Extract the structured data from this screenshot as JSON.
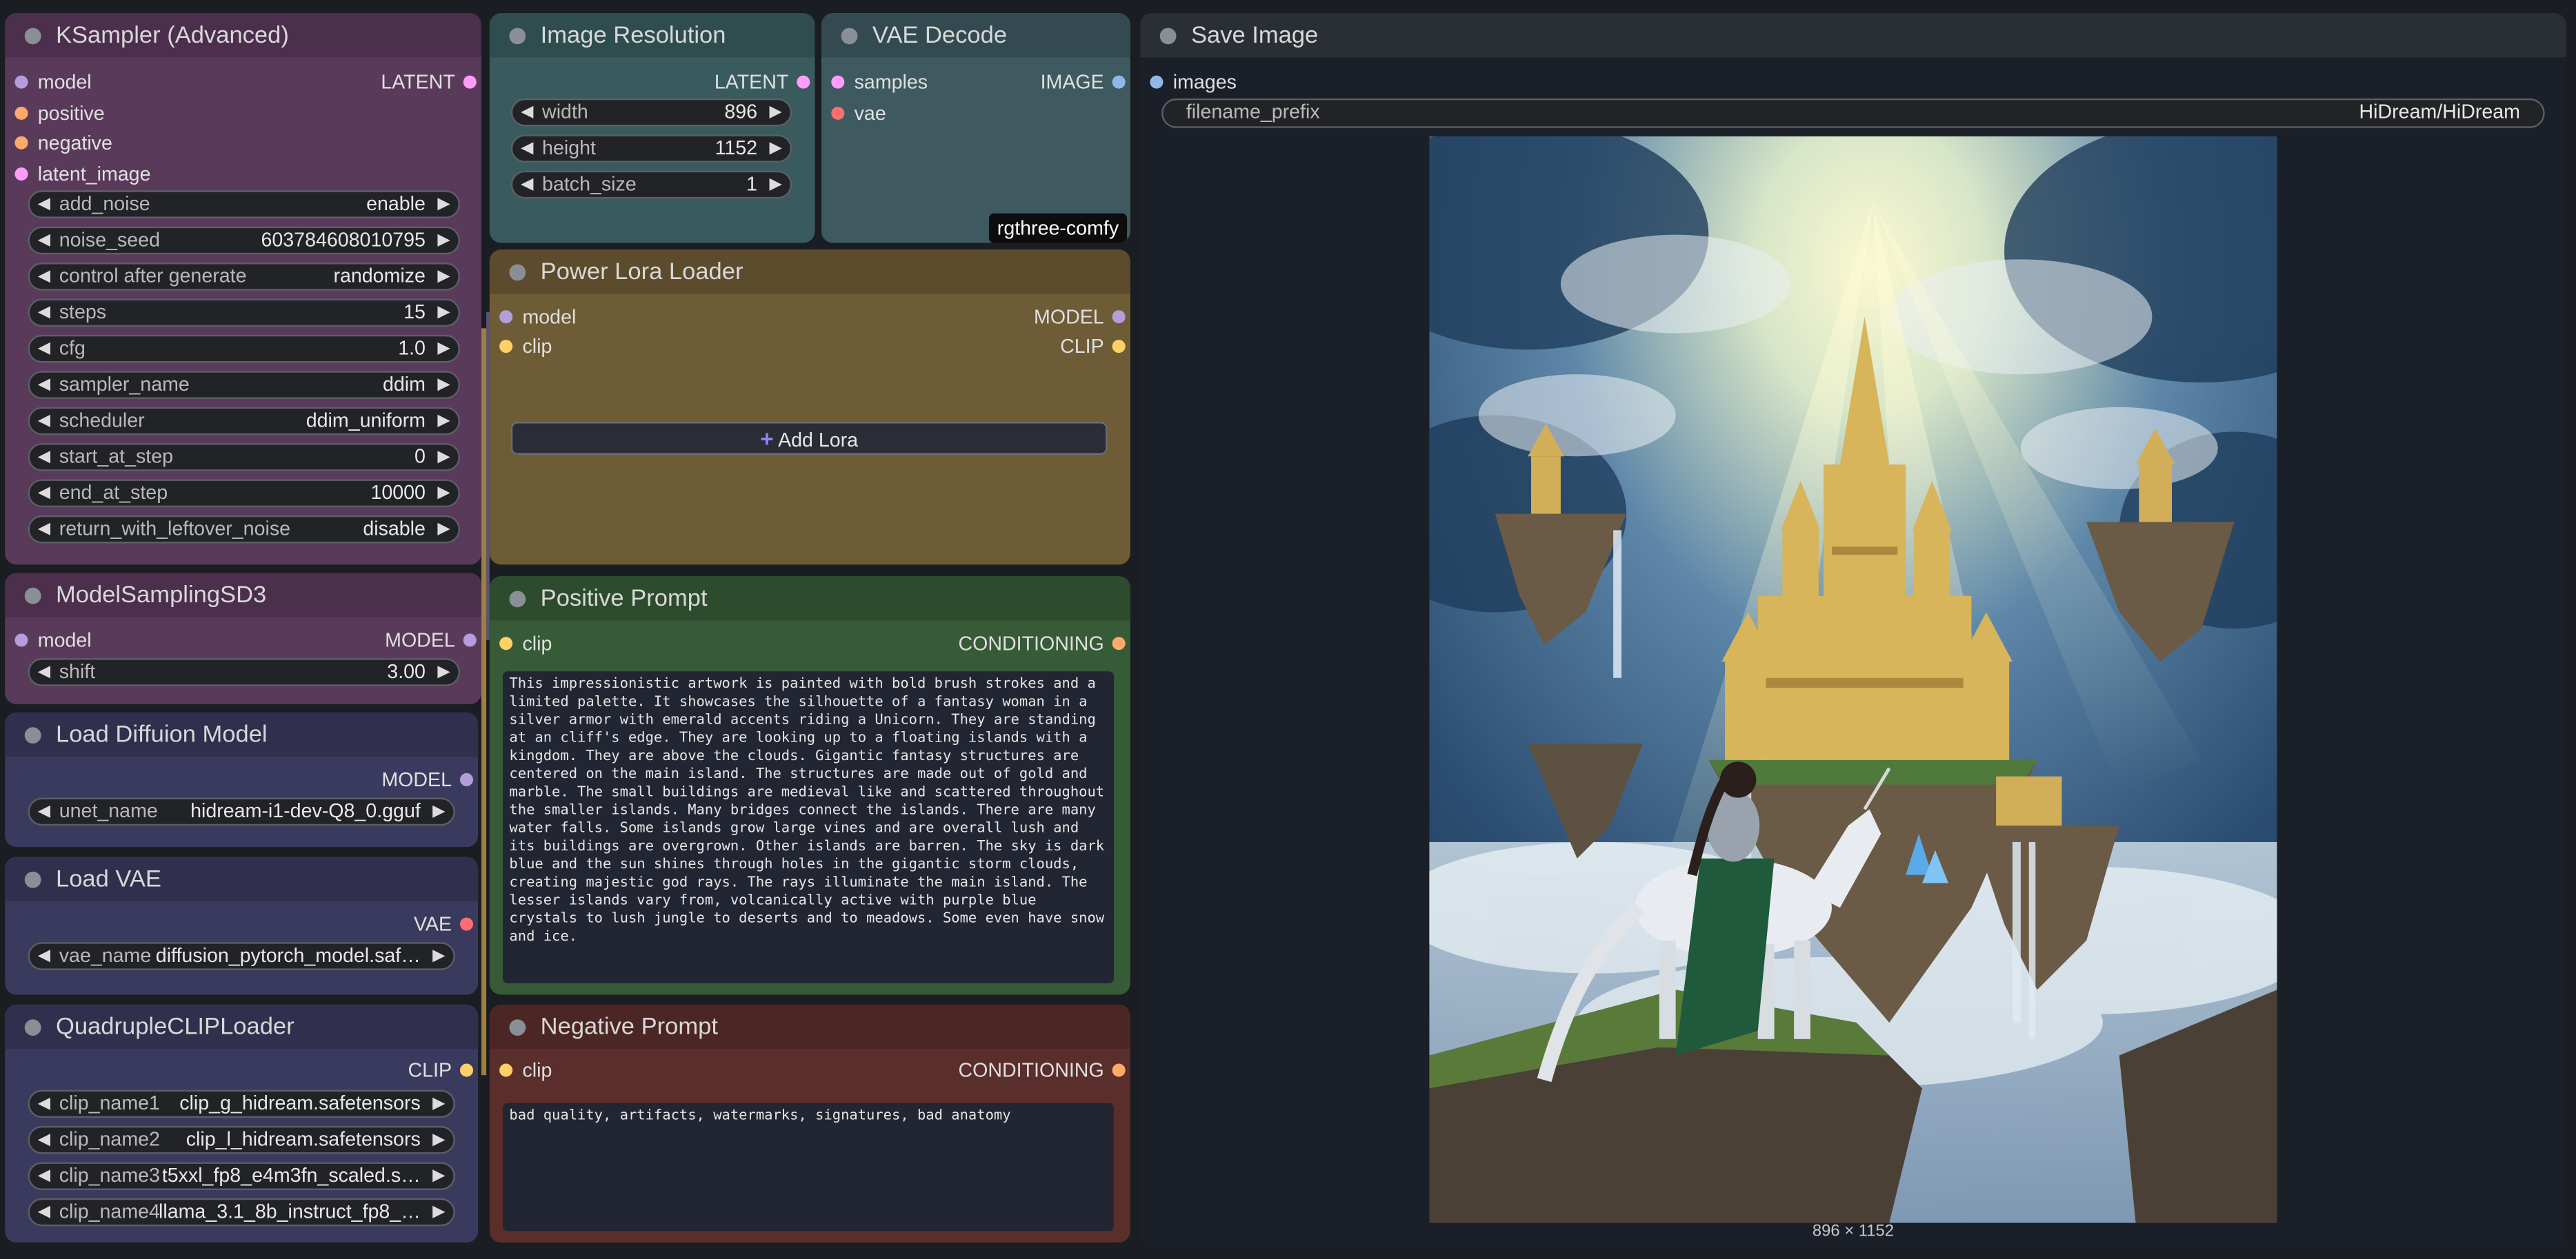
{
  "colors": {
    "canvas": "#1a1d21",
    "ksampler": "#5a3a5b",
    "image_resolution": "#395b5e",
    "vae_decode": "#3e5a60",
    "lora": "#6e5c36",
    "positive": "#375a37",
    "negative": "#5a2e2b",
    "loader": "#3a3a5e",
    "pin_model": "#b39ddb",
    "pin_clip": "#ffd066",
    "pin_latent": "#ff9cf9",
    "pin_conditioning": "#ffa96b",
    "pin_image": "#8fb8e8",
    "pin_vae": "#ff6e6e"
  },
  "ksampler": {
    "title": "KSampler (Advanced)",
    "inputs": [
      "model",
      "positive",
      "negative",
      "latent_image"
    ],
    "output": "LATENT",
    "widgets": [
      {
        "label": "add_noise",
        "value": "enable"
      },
      {
        "label": "noise_seed",
        "value": "603784608010795"
      },
      {
        "label": "control after generate",
        "value": "randomize"
      },
      {
        "label": "steps",
        "value": "15"
      },
      {
        "label": "cfg",
        "value": "1.0"
      },
      {
        "label": "sampler_name",
        "value": "ddim"
      },
      {
        "label": "scheduler",
        "value": "ddim_uniform"
      },
      {
        "label": "start_at_step",
        "value": "0"
      },
      {
        "label": "end_at_step",
        "value": "10000"
      },
      {
        "label": "return_with_leftover_noise",
        "value": "disable"
      }
    ]
  },
  "image_resolution": {
    "title": "Image Resolution",
    "output": "LATENT",
    "widgets": [
      {
        "label": "width",
        "value": "896"
      },
      {
        "label": "height",
        "value": "1152"
      },
      {
        "label": "batch_size",
        "value": "1"
      }
    ]
  },
  "vae_decode": {
    "title": "VAE Decode",
    "inputs": [
      "samples",
      "vae"
    ],
    "output": "IMAGE",
    "badge": "rgthree-comfy"
  },
  "save_image": {
    "title": "Save Image",
    "input": "images",
    "widget": {
      "label": "filename_prefix",
      "value": "HiDream/HiDream"
    },
    "image_size": "896 × 1152"
  },
  "lora": {
    "title": "Power Lora Loader",
    "inputs": [
      "model",
      "clip"
    ],
    "outputs": [
      "MODEL",
      "CLIP"
    ],
    "add_button": "Add Lora",
    "add_icon": "plus-icon"
  },
  "model_sampling": {
    "title": "ModelSamplingSD3",
    "input": "model",
    "output": "MODEL",
    "widget": {
      "label": "shift",
      "value": "3.00"
    }
  },
  "positive": {
    "title": "Positive Prompt",
    "input": "clip",
    "output": "CONDITIONING",
    "text": "This impressionistic artwork is painted with bold brush strokes and a limited palette. It showcases the silhouette of a fantasy woman in a silver armor with emerald accents riding a Unicorn. They are standing at an cliff's edge. They are looking up to a floating islands with a kingdom. They are above the clouds. Gigantic fantasy structures are centered on the main island. The structures are made out of gold and marble. The small buildings are medieval like and scattered throughout the smaller islands. Many bridges connect the islands. There are many water falls. Some islands grow large vines and are overall lush and its buildings are overgrown. Other islands are barren. The sky is dark blue and the sun shines through holes in the gigantic storm clouds, creating majestic god rays. The rays illuminate the main island. The lesser islands vary from, volcanically active with purple blue crystals to lush jungle to deserts and to meadows. Some even have snow and ice."
  },
  "negative": {
    "title": "Negative Prompt",
    "input": "clip",
    "output": "CONDITIONING",
    "text": "bad quality, artifacts, watermarks, signatures, bad anatomy"
  },
  "diffusion_loader": {
    "title": "Load Diffuion Model",
    "output": "MODEL",
    "widget": {
      "label": "unet_name",
      "value": "hidream-i1-dev-Q8_0.gguf"
    }
  },
  "vae_loader": {
    "title": "Load VAE",
    "output": "VAE",
    "widget": {
      "label": "vae_name",
      "value": "diffusion_pytorch_model.saf…"
    }
  },
  "clip_loader": {
    "title": "QuadrupleCLIPLoader",
    "output": "CLIP",
    "widgets": [
      {
        "label": "clip_name1",
        "value": "clip_g_hidream.safetensors"
      },
      {
        "label": "clip_name2",
        "value": "clip_l_hidream.safetensors"
      },
      {
        "label": "clip_name3",
        "value": "t5xxl_fp8_e4m3fn_scaled.s…"
      },
      {
        "label": "clip_name4",
        "value": "llama_3.1_8b_instruct_fp8_…"
      }
    ]
  },
  "ui": {
    "arrow_left": "◀",
    "arrow_right": "▶"
  }
}
